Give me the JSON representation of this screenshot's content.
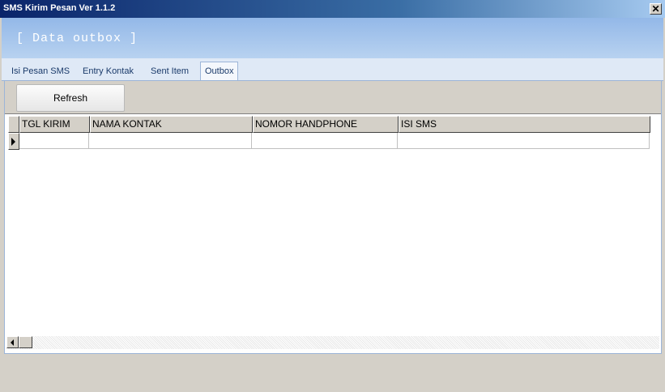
{
  "window": {
    "title": "SMS Kirim Pesan Ver 1.1.2",
    "close_label": "✕"
  },
  "header": {
    "title": "[ Data outbox ]"
  },
  "tabs": [
    {
      "label": "Isi Pesan SMS"
    },
    {
      "label": "Entry Kontak"
    },
    {
      "label": "Sent Item"
    },
    {
      "label": "Outbox"
    }
  ],
  "active_tab": "Outbox",
  "toolbar": {
    "refresh_label": "Refresh"
  },
  "grid": {
    "columns": [
      "TGL KIRIM",
      "NAMA KONTAK",
      "NOMOR HANDPHONE",
      "ISI SMS"
    ],
    "rows": [
      [
        "",
        "",
        "",
        ""
      ]
    ]
  }
}
